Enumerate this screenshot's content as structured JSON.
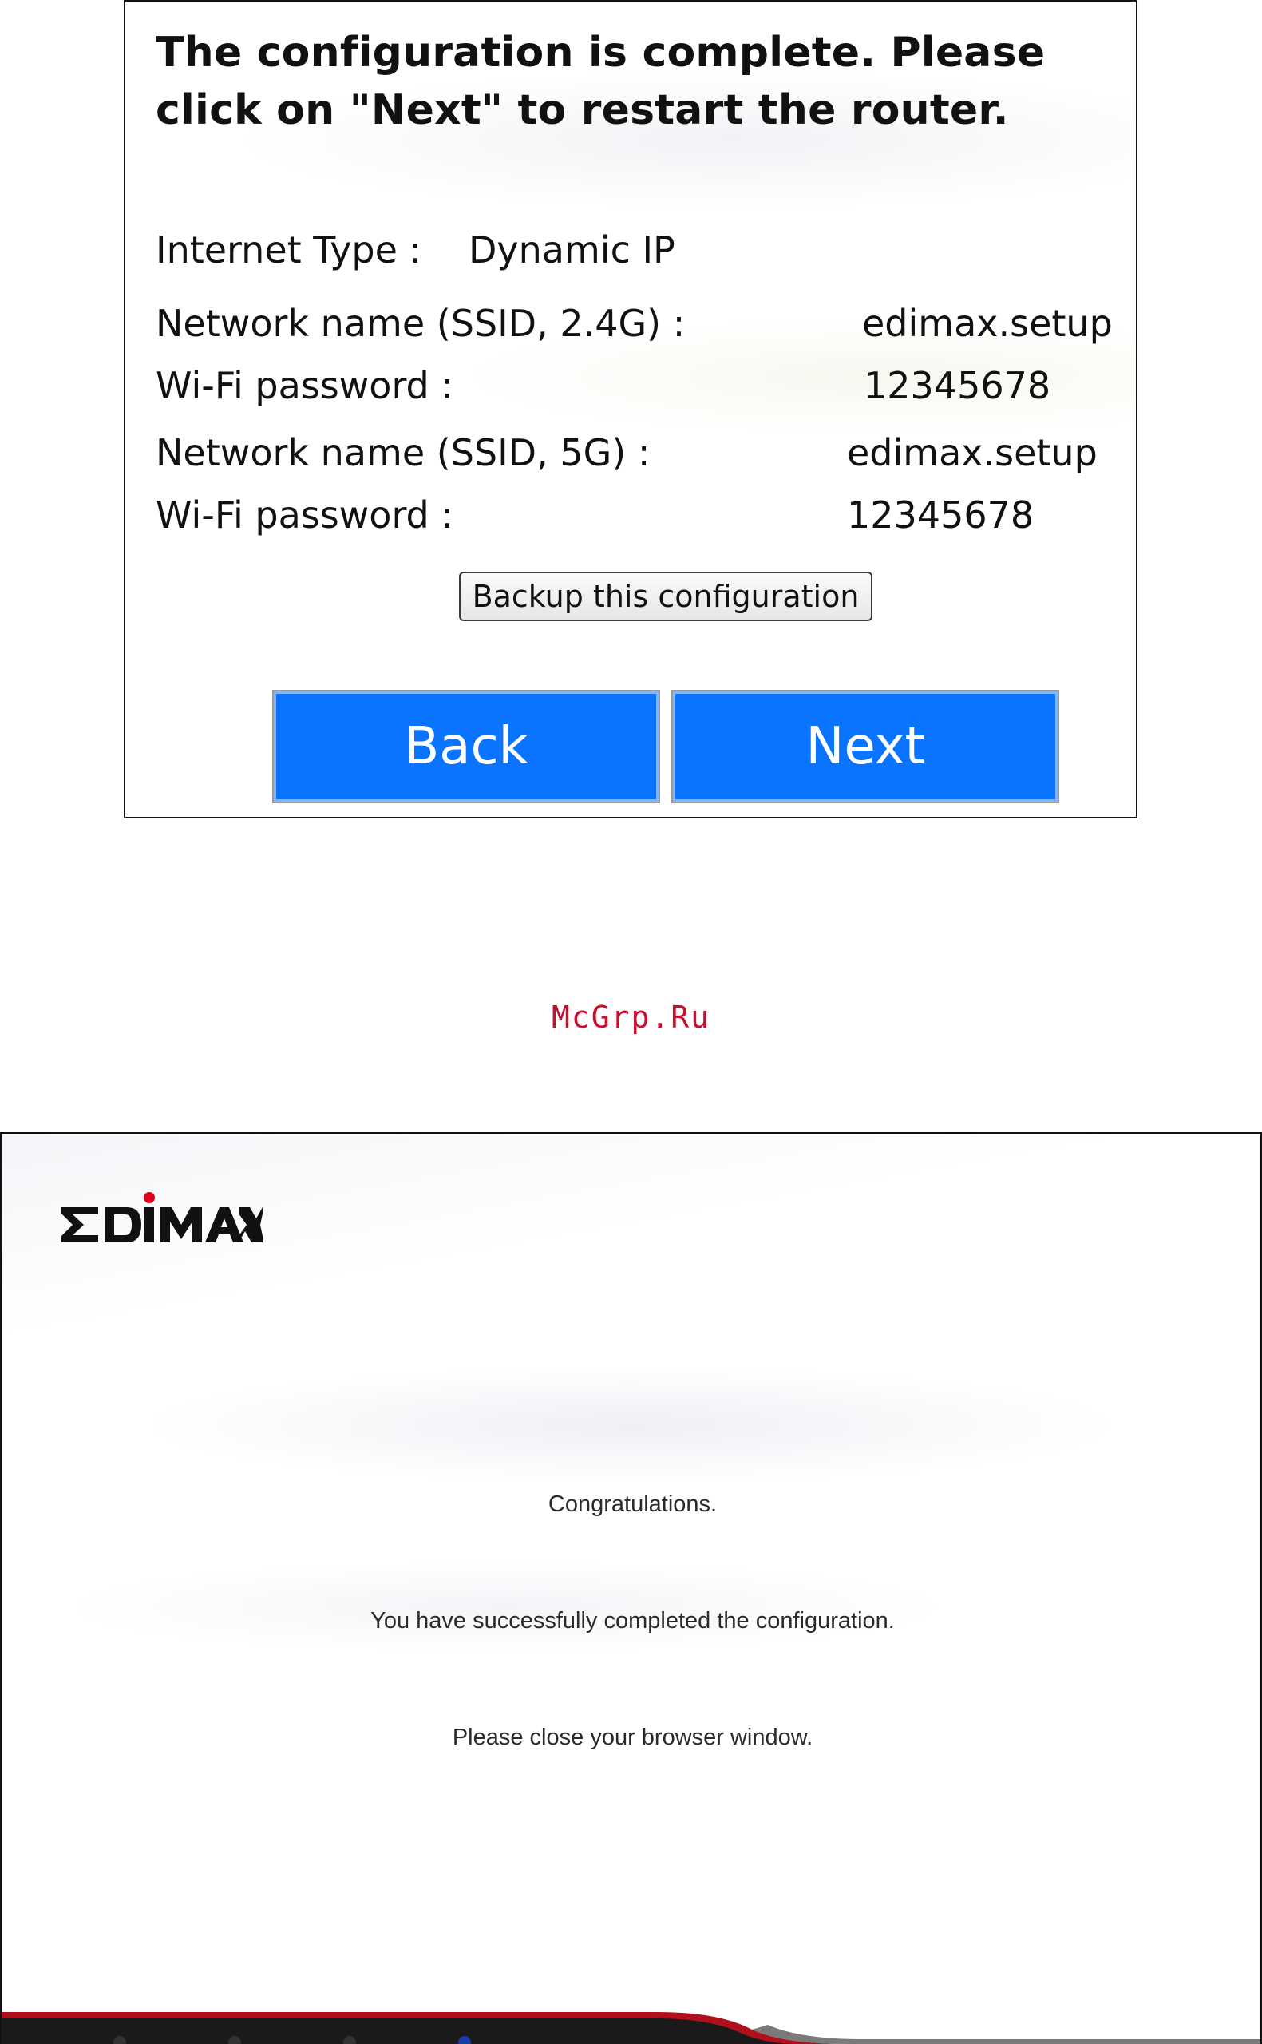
{
  "panel1": {
    "heading": "The configuration is complete. Please click on \"Next\" to restart the router.",
    "rows": [
      {
        "label": "Internet Type :",
        "value": "Dynamic IP"
      },
      {
        "label": "Network name (SSID, 2.4G) :",
        "value": "edimax.setup"
      },
      {
        "label": "Wi-Fi password :",
        "value": "12345678"
      },
      {
        "label": "Network name (SSID, 5G) :",
        "value": "edimax.setup"
      },
      {
        "label": "Wi-Fi password :",
        "value": "12345678"
      }
    ],
    "backup_label": "Backup this configuration",
    "back_label": "Back",
    "next_label": "Next"
  },
  "watermark": "McGrp.Ru",
  "panel2": {
    "logo_text": "EDIMAX",
    "messages": [
      "Congratulations.",
      "You have successfully completed the configuration.",
      "Please close your browser window."
    ]
  },
  "colors": {
    "button_blue": "#0a74ff",
    "watermark_red": "#c8102e",
    "logo_dot_red": "#e0001b",
    "footer_red": "#b0101c"
  }
}
